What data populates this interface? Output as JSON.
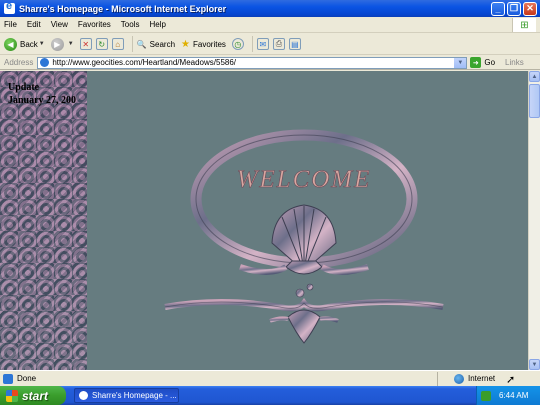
{
  "window": {
    "title": "Sharre's Homepage - Microsoft Internet Explorer"
  },
  "menu": [
    "File",
    "Edit",
    "View",
    "Favorites",
    "Tools",
    "Help"
  ],
  "toolbar": {
    "back": "Back",
    "search": "Search",
    "favorites": "Favorites"
  },
  "address": {
    "label": "Address",
    "url": "http://www.geocities.com/Heartland/Meadows/5586/",
    "go": "Go",
    "links": "Links"
  },
  "page": {
    "update_label": "Update",
    "update_date": "January 27, 200",
    "welcome": "WELCOME"
  },
  "status": {
    "text": "Done",
    "zone": "Internet"
  },
  "taskbar": {
    "start": "start",
    "task": "Sharre's Homepage - ...",
    "clock": "6:44 AM"
  },
  "colors": {
    "page_bg": "#667c80",
    "xp_blue": "#0a54e3",
    "welcome_pink": "#d8a7a0"
  }
}
